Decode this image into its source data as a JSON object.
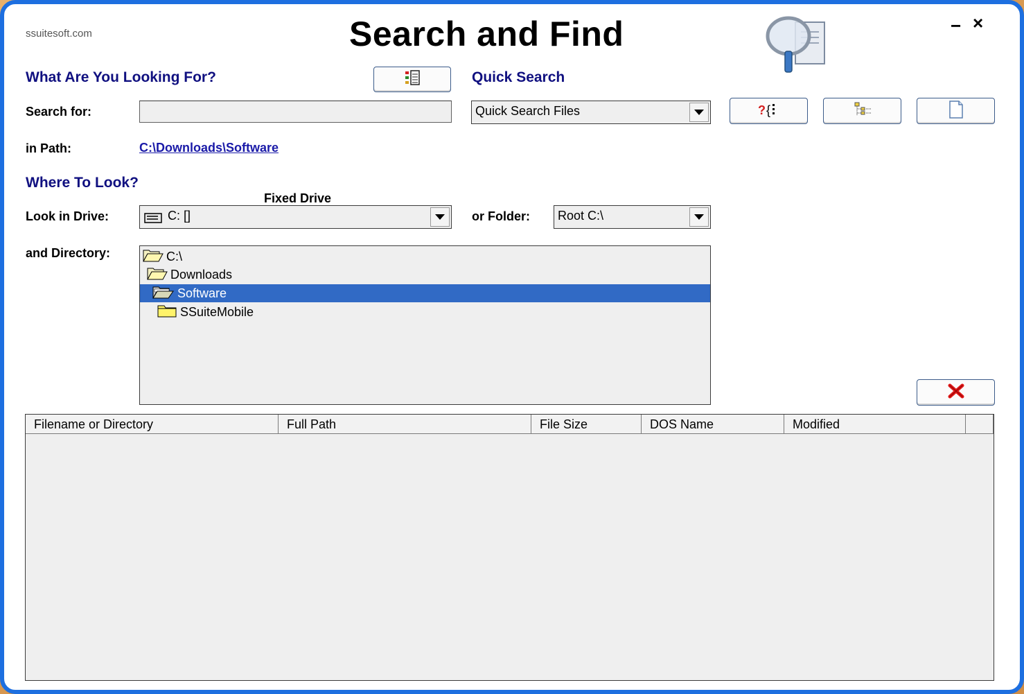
{
  "window": {
    "site": "ssuitesoft.com",
    "title": "Search and Find",
    "minimize_glyph": "−",
    "close_glyph": "×"
  },
  "looking_for": {
    "heading": "What Are You Looking For?",
    "search_label": "Search for:",
    "search_value": "",
    "path_label": "in Path:",
    "path_value": "C:\\Downloads\\Software"
  },
  "quick_search": {
    "heading": "Quick Search",
    "selected": "Quick Search Files"
  },
  "where": {
    "heading": "Where To Look?",
    "drive_type": "Fixed Drive",
    "drive_label": "Look in Drive:",
    "drive_value": "C: []",
    "folder_label": "or Folder:",
    "folder_value": "Root C:\\",
    "directory_label": "and Directory:",
    "directories": [
      "C:\\",
      "Downloads",
      "Software",
      "SSuiteMobile"
    ],
    "selected_directory": "Software"
  },
  "results": {
    "columns": [
      "Filename or Directory",
      "Full Path",
      "File Size",
      "DOS Name",
      "Modified"
    ]
  },
  "icons": {
    "app": "magnifier-document-icon",
    "options": "properties-icon",
    "help": "help-icon",
    "tree": "tree-view-icon",
    "new": "blank-page-icon",
    "clear": "red-x-icon"
  },
  "colors": {
    "frame_border": "#1d6fe0",
    "heading": "#101080",
    "link": "#1a1aa8",
    "selection": "#316ac5",
    "clear_x": "#e01818"
  }
}
